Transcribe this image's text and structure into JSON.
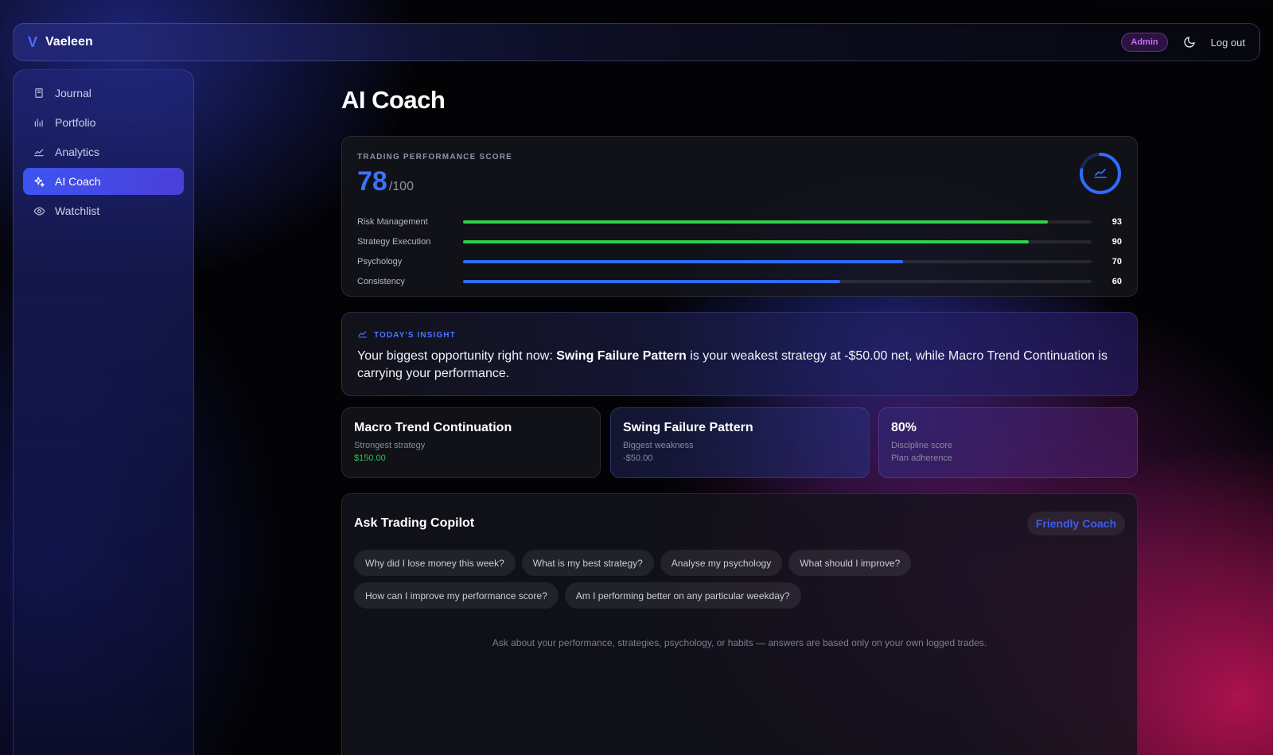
{
  "app": {
    "brand_mark": "V",
    "brand_name": "Vaeleen"
  },
  "topbar": {
    "badge": "Admin",
    "theme_icon": "moon-icon",
    "logout_label": "Log out"
  },
  "sidebar": {
    "items": [
      {
        "label": "Journal",
        "icon": "journal-icon",
        "active": false
      },
      {
        "label": "Portfolio",
        "icon": "bar-chart-icon",
        "active": false
      },
      {
        "label": "Analytics",
        "icon": "line-chart-icon",
        "active": false
      },
      {
        "label": "AI Coach",
        "icon": "sparkles-icon",
        "active": true
      },
      {
        "label": "Watchlist",
        "icon": "eye-icon",
        "active": false
      }
    ]
  },
  "page": {
    "title": "AI Coach"
  },
  "score": {
    "eyebrow": "TRADING PERFORMANCE SCORE",
    "value": "78",
    "max": "/100",
    "metrics": [
      {
        "label": "Risk Management",
        "value": "93",
        "percent": 93,
        "color": "#2fd24a"
      },
      {
        "label": "Strategy Execution",
        "value": "90",
        "percent": 90,
        "color": "#2fd24a"
      },
      {
        "label": "Psychology",
        "value": "70",
        "percent": 70,
        "color": "#2f6bff"
      },
      {
        "label": "Consistency",
        "value": "60",
        "percent": 60,
        "color": "#2f6bff"
      }
    ],
    "ring_percent": 78
  },
  "insight": {
    "eyebrow": "TODAY'S INSIGHT",
    "text_prefix": "Your biggest opportunity right now: ",
    "text_bold": "Swing Failure Pattern",
    "text_suffix": " is your weakest strategy at -$50.00 net, while Macro Trend Continuation is carrying your performance."
  },
  "stats": [
    {
      "title": "Macro Trend Continuation",
      "subtitle": "Strongest strategy",
      "value": "$150.00",
      "value_color": "#33c24d"
    },
    {
      "title": "Swing Failure Pattern",
      "subtitle": "Biggest weakness",
      "value": "-$50.00",
      "value_color": "#858a9f"
    },
    {
      "title": "80%",
      "subtitle": "Discipline score",
      "value": "Plan adherence",
      "value_color": "#858a9f"
    }
  ],
  "copilot": {
    "title": "Ask Trading Copilot",
    "mode": "Friendly Coach",
    "suggestions": [
      "Why did I lose money this week?",
      "What is my best strategy?",
      "Analyse my psychology",
      "What should I improve?",
      "How can I improve my performance score?",
      "Am I performing better on any particular weekday?"
    ],
    "hint": "Ask about your performance, strategies, psychology, or habits — answers are based only on your own logged trades."
  },
  "colors": {
    "accent": "#3b72ff",
    "success": "#2fd24a",
    "admin": "#c86aff"
  }
}
